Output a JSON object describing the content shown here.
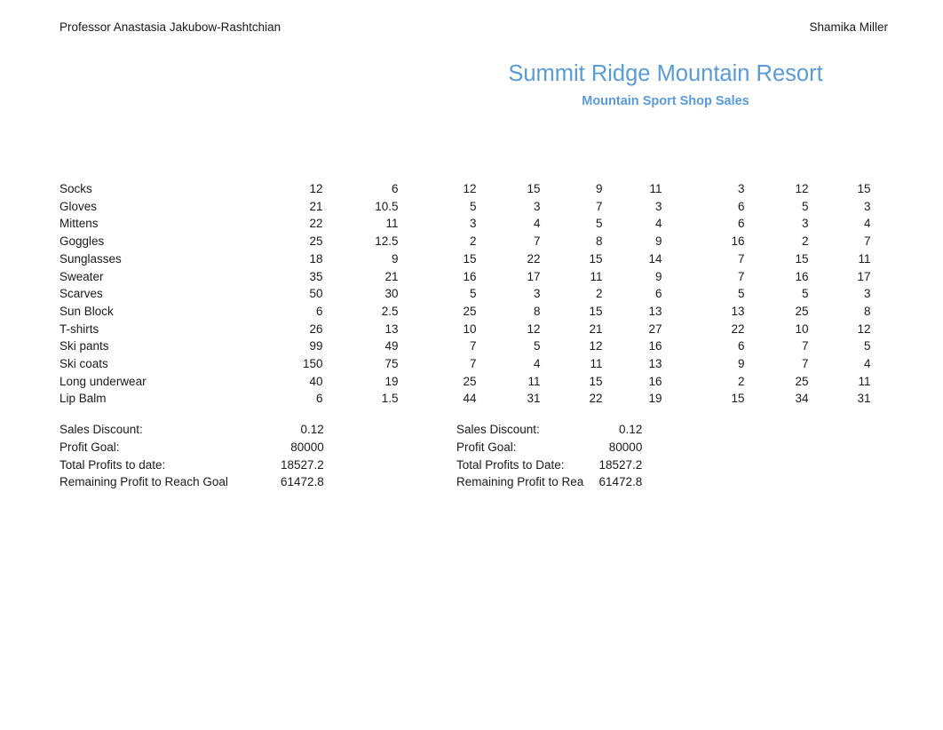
{
  "header": {
    "left_name": "Professor Anastasia Jakubow-Rashtchian",
    "right_name": "Shamika Miller"
  },
  "titles": {
    "main": "Summit Ridge Mountain Resort",
    "sub": "Mountain Sport Shop Sales",
    "accent_color": "#5B9BD5"
  },
  "table": {
    "rows": [
      {
        "item": "Socks",
        "c1": "12",
        "c2": "6",
        "c3": "12",
        "c4": "15",
        "c5": "9",
        "c6": "11",
        "c7": "3",
        "c8": "12",
        "c9": "15"
      },
      {
        "item": "Gloves",
        "c1": "21",
        "c2": "10.5",
        "c3": "5",
        "c4": "3",
        "c5": "7",
        "c6": "3",
        "c7": "6",
        "c8": "5",
        "c9": "3"
      },
      {
        "item": "Mittens",
        "c1": "22",
        "c2": "11",
        "c3": "3",
        "c4": "4",
        "c5": "5",
        "c6": "4",
        "c7": "6",
        "c8": "3",
        "c9": "4"
      },
      {
        "item": "Goggles",
        "c1": "25",
        "c2": "12.5",
        "c3": "2",
        "c4": "7",
        "c5": "8",
        "c6": "9",
        "c7": "16",
        "c8": "2",
        "c9": "7"
      },
      {
        "item": "Sunglasses",
        "c1": "18",
        "c2": "9",
        "c3": "15",
        "c4": "22",
        "c5": "15",
        "c6": "14",
        "c7": "7",
        "c8": "15",
        "c9": "11"
      },
      {
        "item": "Sweater",
        "c1": "35",
        "c2": "21",
        "c3": "16",
        "c4": "17",
        "c5": "11",
        "c6": "9",
        "c7": "7",
        "c8": "16",
        "c9": "17"
      },
      {
        "item": "Scarves",
        "c1": "50",
        "c2": "30",
        "c3": "5",
        "c4": "3",
        "c5": "2",
        "c6": "6",
        "c7": "5",
        "c8": "5",
        "c9": "3"
      },
      {
        "item": "Sun Block",
        "c1": "6",
        "c2": "2.5",
        "c3": "25",
        "c4": "8",
        "c5": "15",
        "c6": "13",
        "c7": "13",
        "c8": "25",
        "c9": "8"
      },
      {
        "item": "T-shirts",
        "c1": "26",
        "c2": "13",
        "c3": "10",
        "c4": "12",
        "c5": "21",
        "c6": "27",
        "c7": "22",
        "c8": "10",
        "c9": "12"
      },
      {
        "item": "Ski pants",
        "c1": "99",
        "c2": "49",
        "c3": "7",
        "c4": "5",
        "c5": "12",
        "c6": "16",
        "c7": "6",
        "c8": "7",
        "c9": "5"
      },
      {
        "item": "Ski coats",
        "c1": "150",
        "c2": "75",
        "c3": "7",
        "c4": "4",
        "c5": "11",
        "c6": "13",
        "c7": "9",
        "c8": "7",
        "c9": "4"
      },
      {
        "item": "Long underwear",
        "c1": "40",
        "c2": "19",
        "c3": "25",
        "c4": "11",
        "c5": "15",
        "c6": "16",
        "c7": "2",
        "c8": "25",
        "c9": "11"
      },
      {
        "item": "Lip Balm",
        "c1": "6",
        "c2": "1.5",
        "c3": "44",
        "c4": "31",
        "c5": "22",
        "c6": "19",
        "c7": "15",
        "c8": "34",
        "c9": "31"
      }
    ]
  },
  "summary_left": {
    "rows": [
      {
        "label": "Sales Discount:",
        "value": "0.12"
      },
      {
        "label": "Profit Goal:",
        "value": "80000"
      },
      {
        "label": "Total Profits to date:",
        "value": "18527.2"
      },
      {
        "label": "Remaining Profit to Reach Goal",
        "value": "61472.8"
      }
    ]
  },
  "summary_right": {
    "rows": [
      {
        "label": "Sales Discount:",
        "value": "0.12"
      },
      {
        "label": "Profit Goal:",
        "value": "80000"
      },
      {
        "label": "Total Profits to Date:",
        "value": "18527.2"
      },
      {
        "label": "Remaining Profit to Rea",
        "value": "61472.8"
      }
    ]
  }
}
